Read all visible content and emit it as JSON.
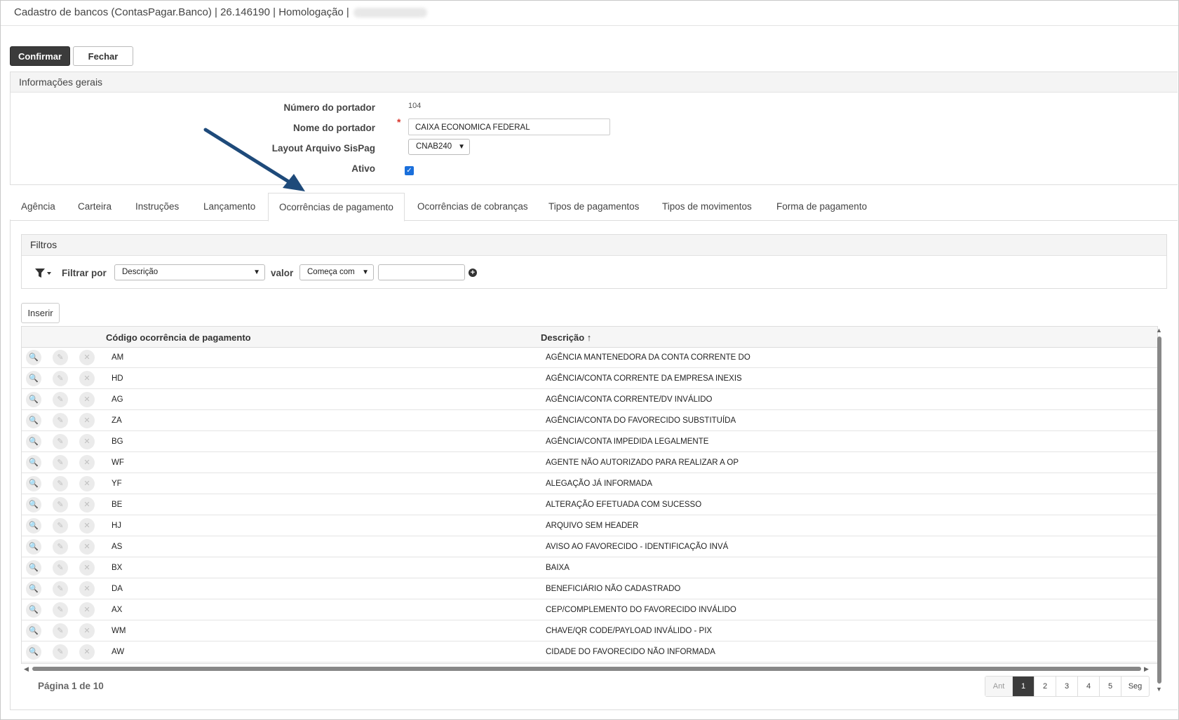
{
  "window": {
    "title": "Cadastro de bancos (ContasPagar.Banco) | 26.146190 | Homologação |"
  },
  "toolbar": {
    "confirm_label": "Confirmar",
    "close_label": "Fechar"
  },
  "general": {
    "header": "Informações gerais",
    "number_label": "Número do portador",
    "number_value": "104",
    "name_label": "Nome do portador",
    "name_value": "CAIXA ECONOMICA FEDERAL",
    "layout_label": "Layout Arquivo SisPag",
    "layout_value": "CNAB240",
    "active_label": "Ativo",
    "active_checked": true
  },
  "tabs": [
    {
      "label": "Agência"
    },
    {
      "label": "Carteira"
    },
    {
      "label": "Instruções"
    },
    {
      "label": "Lançamento"
    },
    {
      "label": "Ocorrências de pagamento",
      "active": true
    },
    {
      "label": "Ocorrências de cobranças"
    },
    {
      "label": "Tipos de pagamentos"
    },
    {
      "label": "Tipos de movimentos"
    },
    {
      "label": "Forma de pagamento"
    }
  ],
  "filters": {
    "header": "Filtros",
    "filter_by_label": "Filtrar por",
    "field_value": "Descrição",
    "value_label": "valor",
    "operator_value": "Começa com",
    "value_text": ""
  },
  "insert_label": "Inserir",
  "table": {
    "col_code": "Código ocorrência de pagamento",
    "col_desc": "Descrição",
    "rows": [
      {
        "code": "AM",
        "desc": "AGÊNCIA MANTENEDORA DA CONTA CORRENTE DO"
      },
      {
        "code": "HD",
        "desc": "AGÊNCIA/CONTA CORRENTE DA EMPRESA INEXIS"
      },
      {
        "code": "AG",
        "desc": "AGÊNCIA/CONTA CORRENTE/DV INVÁLIDO"
      },
      {
        "code": "ZA",
        "desc": "AGÊNCIA/CONTA DO FAVORECIDO SUBSTITUÍDA"
      },
      {
        "code": "BG",
        "desc": "AGÊNCIA/CONTA IMPEDIDA LEGALMENTE"
      },
      {
        "code": "WF",
        "desc": "AGENTE NÃO AUTORIZADO PARA REALIZAR A OP"
      },
      {
        "code": "YF",
        "desc": "ALEGAÇÃO JÁ INFORMADA"
      },
      {
        "code": "BE",
        "desc": "ALTERAÇÃO EFETUADA COM SUCESSO"
      },
      {
        "code": "HJ",
        "desc": "ARQUIVO SEM HEADER"
      },
      {
        "code": "AS",
        "desc": "AVISO AO FAVORECIDO - IDENTIFICAÇÃO INVÁ"
      },
      {
        "code": "BX",
        "desc": "BAIXA"
      },
      {
        "code": "DA",
        "desc": "BENEFICIÁRIO NÃO CADASTRADO"
      },
      {
        "code": "AX",
        "desc": "CEP/COMPLEMENTO DO FAVORECIDO INVÁLIDO"
      },
      {
        "code": "WM",
        "desc": "CHAVE/QR CODE/PAYLOAD INVÁLIDO - PIX"
      },
      {
        "code": "AW",
        "desc": "CIDADE DO FAVORECIDO NÃO INFORMADA"
      }
    ]
  },
  "pagination": {
    "info": "Página 1 de 10",
    "prev": "Ant",
    "pages": [
      "1",
      "2",
      "3",
      "4",
      "5"
    ],
    "next": "Seg"
  }
}
